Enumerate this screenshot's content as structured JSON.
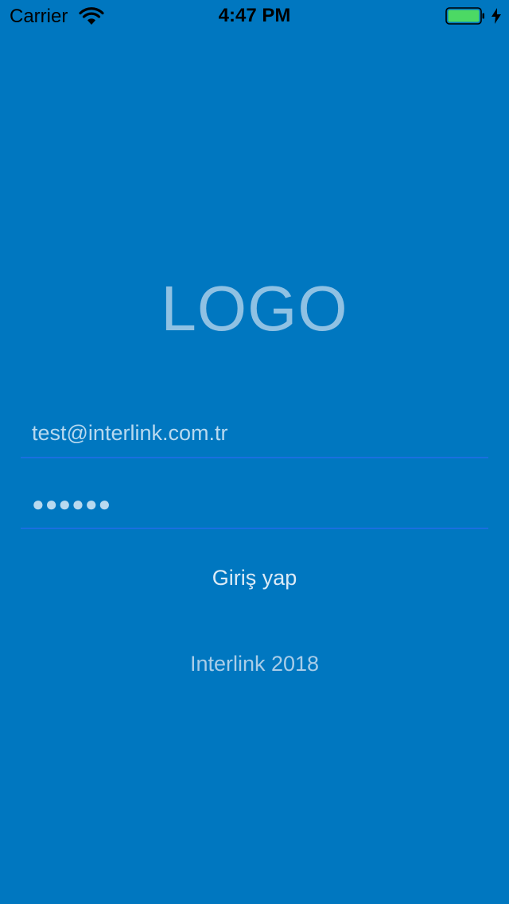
{
  "status_bar": {
    "carrier": "Carrier",
    "time": "4:47 PM",
    "battery_color": "#4CD964"
  },
  "logo": {
    "text": "LOGO"
  },
  "form": {
    "email_value": "test@interlink.com.tr",
    "password_mask": "●●●●●●"
  },
  "login_button": {
    "label": "Giriş yap"
  },
  "footer": {
    "text": "Interlink 2018"
  },
  "colors": {
    "background": "#0077C0",
    "underline": "#1A6FE0"
  }
}
